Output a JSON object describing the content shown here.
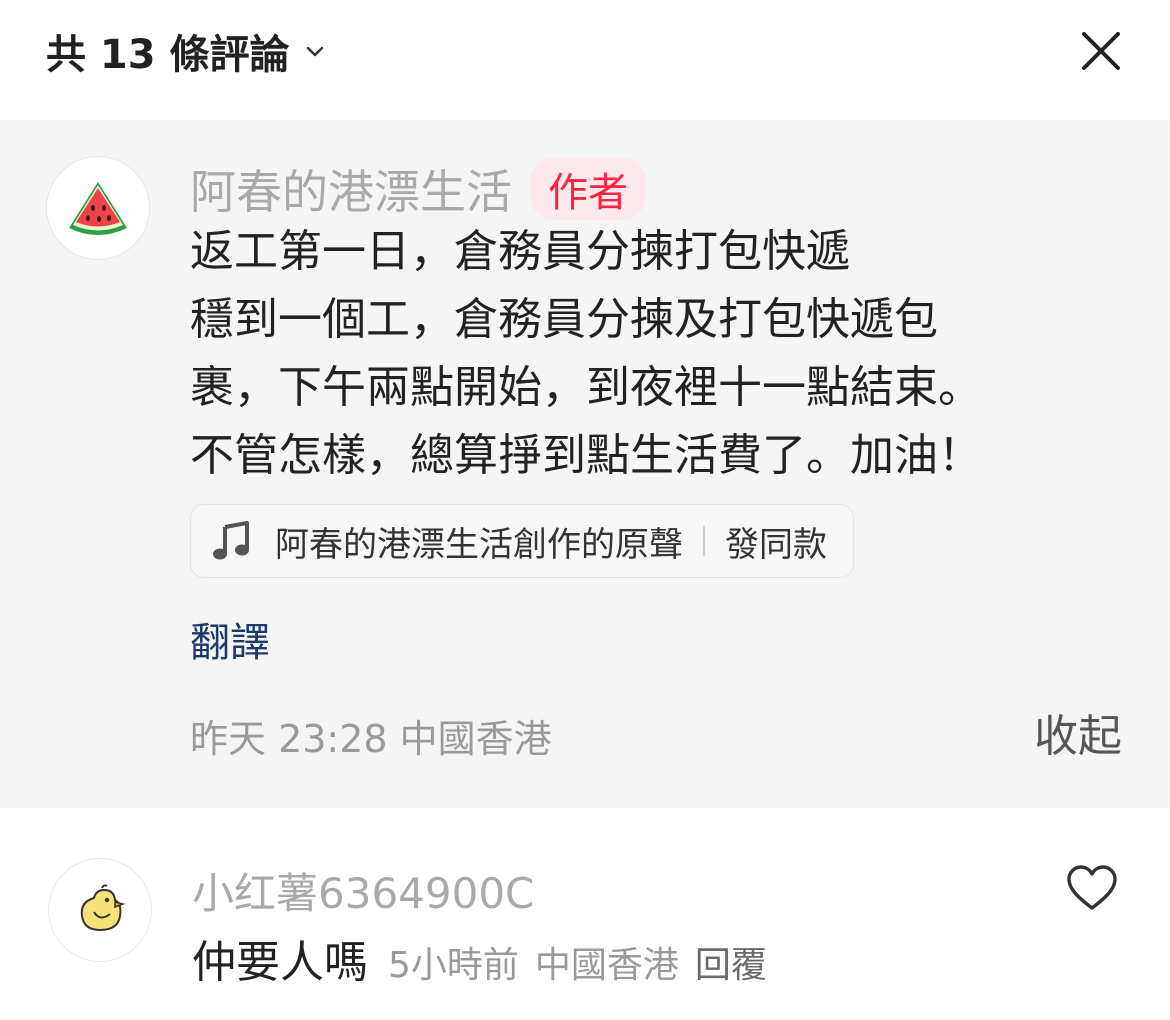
{
  "header": {
    "comment_count_label": "共 13 條評論",
    "close_icon": "close-icon"
  },
  "main_comment": {
    "author_name": "阿春的港漂生活",
    "author_badge": "作者",
    "text_lines": [
      "返工第一日，倉務員分揀打包快遞",
      "穩到一個工，倉務員分揀及打包快遞包",
      "裹，下午兩點開始，到夜裡十一點結束。",
      "不管怎樣，總算掙到點生活費了。加油！"
    ],
    "music": {
      "label": "阿春的港漂生活創作的原聲",
      "action": "發同款",
      "icon": "music-note-icon"
    },
    "translate_label": "翻譯",
    "meta": "昨天 23:28 中國香港",
    "collapse_label": "收起",
    "avatar_icon": "watermelon-icon"
  },
  "reply": {
    "author_name": "小红薯6364900C",
    "text": "仲要人嗎",
    "time": "5小時前",
    "location": "中國香港",
    "reply_label": "回覆",
    "avatar_icon": "chick-icon",
    "like_icon": "heart-icon"
  },
  "colors": {
    "badge_bg": "#fde8eb",
    "badge_text": "#ff2442",
    "translate_link": "#1c3a6b",
    "comment_bg": "#f5f5f5"
  }
}
